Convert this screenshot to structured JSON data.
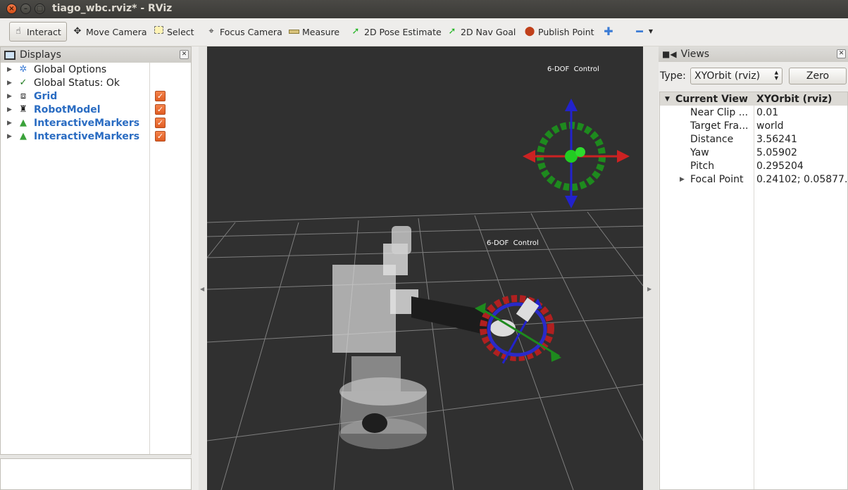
{
  "window": {
    "title": "tiago_wbc.rviz* - RViz"
  },
  "toolbar": {
    "interact": "Interact",
    "move_camera": "Move Camera",
    "select": "Select",
    "focus_camera": "Focus Camera",
    "measure": "Measure",
    "pose_estimate": "2D Pose Estimate",
    "nav_goal": "2D Nav Goal",
    "publish_point": "Publish Point"
  },
  "displays": {
    "title": "Displays",
    "items": [
      {
        "label": "Global Options",
        "icon": "gear-icon",
        "checked": null
      },
      {
        "label": "Global Status: Ok",
        "icon": "checkmark-icon",
        "checked": null
      },
      {
        "label": "Grid",
        "icon": "grid-icon",
        "checked": true
      },
      {
        "label": "RobotModel",
        "icon": "robot-icon",
        "checked": true
      },
      {
        "label": "InteractiveMarkers",
        "icon": "marker-icon",
        "checked": true
      },
      {
        "label": "InteractiveMarkers",
        "icon": "marker-icon",
        "checked": true
      }
    ]
  },
  "viewport": {
    "labels": [
      "6-DOF  Control",
      "6-DOF  Control"
    ],
    "background": "#303030"
  },
  "views": {
    "title": "Views",
    "type_label": "Type:",
    "type_value": "XYOrbit (rviz)",
    "zero_button": "Zero",
    "header": {
      "name": "Current View",
      "value": "XYOrbit (rviz)"
    },
    "props": [
      {
        "name": "Near Clip ...",
        "value": "0.01"
      },
      {
        "name": "Target Fra...",
        "value": "world"
      },
      {
        "name": "Distance",
        "value": "3.56241"
      },
      {
        "name": "Yaw",
        "value": "5.05902"
      },
      {
        "name": "Pitch",
        "value": "0.295204"
      },
      {
        "name": "Focal Point",
        "value": "0.24102; 0.05877..."
      }
    ]
  },
  "colors": {
    "accent_blue": "#2a6cc2",
    "check_orange": "#e05c22",
    "titlebar": "#3c3b37"
  }
}
